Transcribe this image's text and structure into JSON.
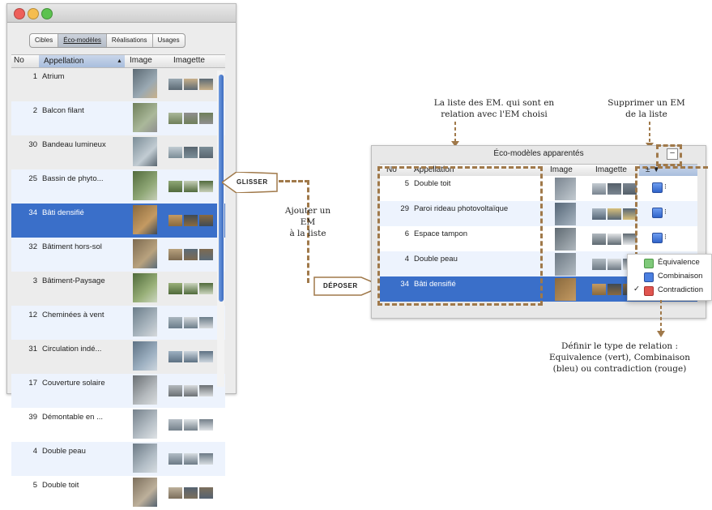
{
  "left_window": {
    "tabs": [
      {
        "label": "Cibles",
        "selected": false
      },
      {
        "label": "Éco-modèles",
        "selected": true
      },
      {
        "label": "Réalisations",
        "selected": false
      },
      {
        "label": "Usages",
        "selected": false
      }
    ],
    "columns": {
      "no": "No",
      "appellation": "Appellation",
      "sort": "▲",
      "image": "Image",
      "imagette": "Imagette"
    },
    "rows": [
      {
        "no": "1",
        "name": "Atrium"
      },
      {
        "no": "2",
        "name": "Balcon filant"
      },
      {
        "no": "30",
        "name": "Bandeau lumineux"
      },
      {
        "no": "25",
        "name": "Bassin de phyto..."
      },
      {
        "no": "34",
        "name": "Bâti densifié",
        "selected": true
      },
      {
        "no": "32",
        "name": "Bâtiment hors-sol"
      },
      {
        "no": "3",
        "name": "Bâtiment-Paysage"
      },
      {
        "no": "12",
        "name": "Cheminées à vent"
      },
      {
        "no": "31",
        "name": "Circulation indé..."
      },
      {
        "no": "17",
        "name": "Couverture solaire"
      },
      {
        "no": "39",
        "name": "Démontable en ..."
      },
      {
        "no": "4",
        "name": "Double peau"
      },
      {
        "no": "5",
        "name": "Double toit"
      }
    ]
  },
  "callouts": {
    "glisser": "GLISSER",
    "deposer": "DÉPOSER"
  },
  "annotations": {
    "ajouter": "Ajouter un\nEM\nà la liste",
    "liste": "La liste des EM. qui sont en\nrelation avec l'EM choisi",
    "supprimer": "Supprimer un EM\nde la liste",
    "definir": "Définir le type de relation :\nEquivalence (vert), Combinaison\n(bleu) ou contradiction (rouge)"
  },
  "right_window": {
    "title": "Éco-modèles apparentés",
    "minus_label": "–",
    "columns": {
      "no": "No",
      "appellation": "Appellation",
      "image": "Image",
      "imagette": "Imagette",
      "rel": "± ▼"
    },
    "rows": [
      {
        "no": "5",
        "name": "Double toit"
      },
      {
        "no": "29",
        "name": "Paroi rideau photovoltaïque"
      },
      {
        "no": "6",
        "name": "Espace tampon"
      },
      {
        "no": "4",
        "name": "Double peau"
      },
      {
        "no": "34",
        "name": "Bâti densifié",
        "selected": true
      }
    ]
  },
  "relation_menu": {
    "items": [
      {
        "label": "Équivalence",
        "color": "#7fc97a",
        "checked": false
      },
      {
        "label": "Combinaison",
        "color": "#4a7fe0",
        "checked": false
      },
      {
        "label": "Contradiction",
        "color": "#e0554f",
        "checked": true
      }
    ],
    "check": "✓"
  },
  "colors": {
    "accent": "#3a6fc9",
    "callout": "#a0794a"
  }
}
